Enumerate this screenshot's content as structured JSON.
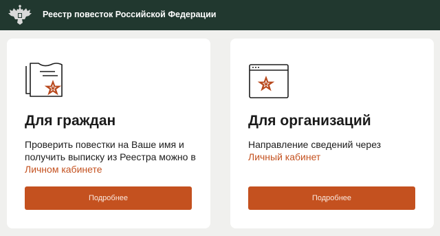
{
  "header": {
    "title": "Реестр повесток Российской Федерации",
    "emblem_icon": "double-headed-eagle-emblem",
    "background": "#21382f"
  },
  "cards": [
    {
      "icon": "document-star-icon",
      "title": "Для граждан",
      "text": "Проверить повестки на Ваше имя и получить выписку из Реестра можно в",
      "link": "Личном кабинете",
      "button": "Подробнее"
    },
    {
      "icon": "browser-window-star-icon",
      "title": "Для организаций",
      "text": "Направление сведений через",
      "link": "Личный кабинет",
      "button": "Подробнее"
    }
  ],
  "colors": {
    "accent": "#c4511f",
    "card_background": "#ffffff",
    "page_background": "#f0f0ee"
  }
}
